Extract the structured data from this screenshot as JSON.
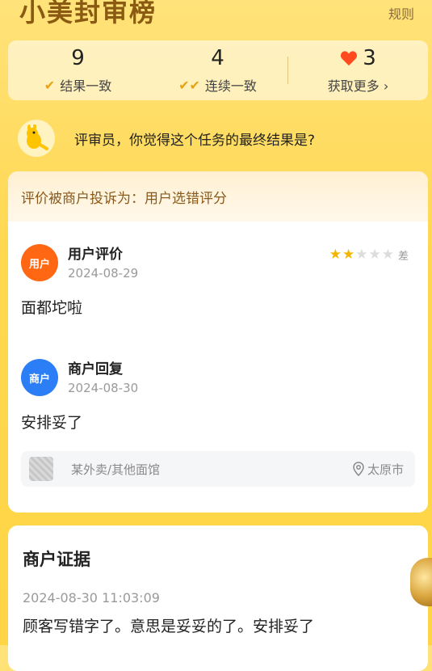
{
  "header": {
    "title": "小美封审榜",
    "rules": "规则"
  },
  "stats": {
    "result_count": "9",
    "result_label": "结果一致",
    "streak_count": "4",
    "streak_label": "连续一致",
    "hearts_count": "3",
    "more_label": "获取更多 ›"
  },
  "prompt": {
    "question": "评审员，你觉得这个任务的最终结果是?"
  },
  "complaint": {
    "text": "评价被商户投诉为：用户选错评分"
  },
  "user_review": {
    "avatar": "用户",
    "title": "用户评价",
    "date": "2024-08-29",
    "content": "面都坨啦",
    "rating": 2,
    "rating_max": 5,
    "rating_label": "差"
  },
  "merchant_reply": {
    "avatar": "商户",
    "title": "商户回复",
    "date": "2024-08-30",
    "content": "安排妥了"
  },
  "store": {
    "name": "某外卖/其他面馆",
    "location": "太原市"
  },
  "evidence": {
    "title": "商户证据",
    "timestamp": "2024-08-30 11:03:09",
    "text": "顾客写错字了。意思是妥妥的了。安排妥了"
  },
  "colors": {
    "accent": "#ffd545",
    "user_avatar": "#ff6712",
    "merchant_avatar": "#2b7ef5",
    "star": "#f2b600"
  }
}
